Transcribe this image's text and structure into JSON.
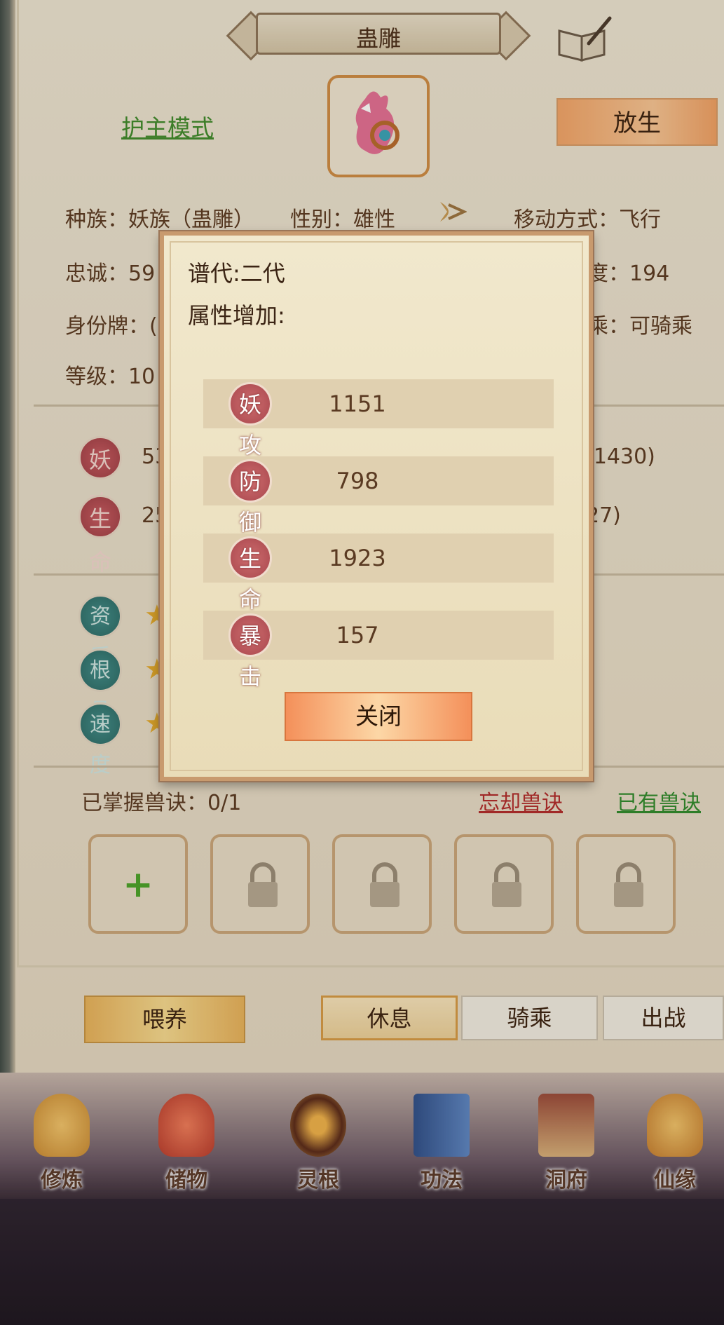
{
  "header": {
    "title": "蛊雕"
  },
  "actions": {
    "guard_mode": "护主模式",
    "release": "放生"
  },
  "info": {
    "race": "种族：妖族（蛊雕）",
    "gender": "性别：雄性",
    "movement": "移动方式：飞行",
    "loyalty": "忠诚：59",
    "speed_value": "度：194",
    "identity": "身份牌：(",
    "ride": "乘：可骑乘",
    "level": "等级：10"
  },
  "stats": {
    "attack_label": "妖攻",
    "attack_value": "53",
    "attack_range": "-1430)",
    "life_label": "生命",
    "life_value": "25",
    "life_range": "27)"
  },
  "aptitude": {
    "a": "资质",
    "b": "根骨",
    "c": "速度"
  },
  "skills": {
    "mastered": "已掌握兽诀：0/1",
    "forget": "忘却兽诀",
    "owned": "已有兽诀"
  },
  "bottom_tabs": {
    "feed": "喂养",
    "rest": "休息",
    "ride": "骑乘",
    "battle": "出战"
  },
  "nav": [
    "修炼",
    "储物",
    "灵根",
    "功法",
    "洞府",
    "仙缘"
  ],
  "modal": {
    "generation": "谱代:二代",
    "attr_title": "属性增加:",
    "rows": [
      {
        "label": "妖攻",
        "value": "1151"
      },
      {
        "label": "防御",
        "value": "798"
      },
      {
        "label": "生命",
        "value": "1923"
      },
      {
        "label": "暴击",
        "value": "157"
      }
    ],
    "close": "关闭"
  },
  "colors": {
    "accent_orange": "#f4905a",
    "link_green": "#3f8a2c",
    "link_red": "#b22b2b"
  },
  "icons": {
    "book": "book-quill-icon",
    "plus": "plus-icon",
    "lock": "lock-icon"
  }
}
